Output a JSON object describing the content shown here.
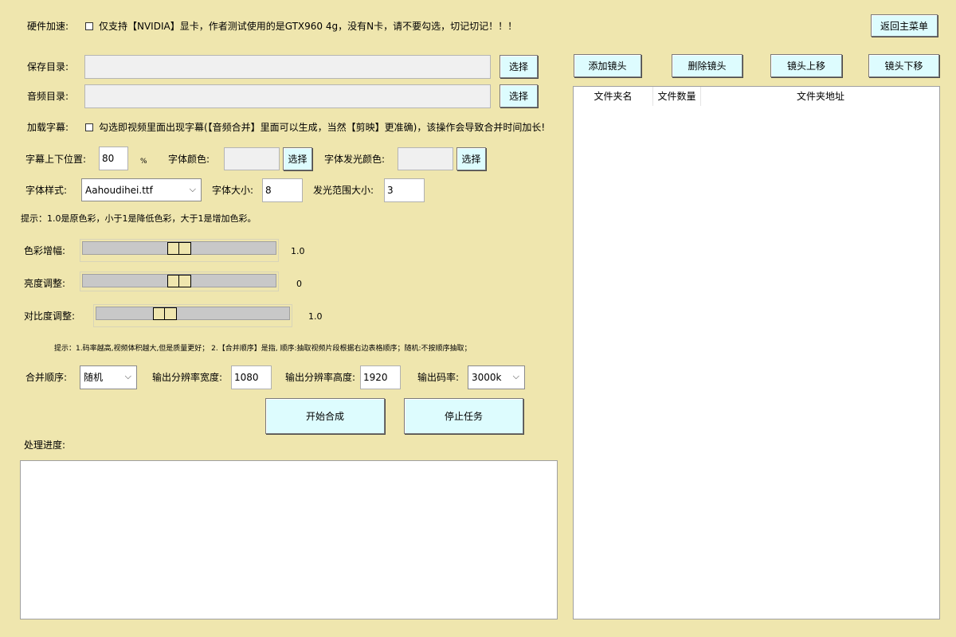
{
  "hardware": {
    "label": "硬件加速:",
    "option_text": "仅支持【NVIDIA】显卡，作者测试使用的是GTX960 4g，没有N卡，请不要勾选，切记切记！！！",
    "checked": false
  },
  "back_button": "返回主菜单",
  "save_dir": {
    "label": "保存目录:",
    "value": "",
    "button": "选择"
  },
  "audio_dir": {
    "label": "音频目录:",
    "value": "",
    "button": "选择"
  },
  "subtitle": {
    "label": "加载字幕:",
    "option_text": "勾选即视频里面出现字幕(【音频合并】里面可以生成，当然【剪映】更准确)，该操作会导致合并时间加长!",
    "checked": false
  },
  "subtitle_position": {
    "label": "字幕上下位置:",
    "value": "80",
    "unit": "%"
  },
  "font_color": {
    "label": "字体颜色:",
    "button": "选择"
  },
  "glow_color": {
    "label": "字体发光颜色:",
    "button": "选择"
  },
  "font_style": {
    "label": "字体样式:",
    "value": "Aahoudihei.ttf"
  },
  "font_size": {
    "label": "字体大小:",
    "value": "8"
  },
  "glow_size": {
    "label": "发光范围大小:",
    "value": "3"
  },
  "hint1": "提示：1.0是原色彩，小于1是降低色彩，大于1是增加色彩。",
  "sliders": [
    {
      "label": "色彩增幅:",
      "value_text": "1.0",
      "level": 0.5
    },
    {
      "label": "亮度调整:",
      "value_text": "0",
      "level": 0.5
    },
    {
      "label": "对比度调整:",
      "value_text": "1.0",
      "level": 0.34
    }
  ],
  "hint2": "提示：1.码率越高,视频体积越大,但是质量更好；  2.【合并顺序】是指,  顺序:抽取视频片段根据右边表格顺序；随机:不按顺序抽取；",
  "merge_order": {
    "label": "合并顺序:",
    "value": "随机"
  },
  "width": {
    "label": "输出分辨率宽度:",
    "value": "1080"
  },
  "height": {
    "label": "输出分辨率高度:",
    "value": "1920"
  },
  "bitrate": {
    "label": "输出码率:",
    "value": "3000k"
  },
  "start_button": "开始合成",
  "stop_button": "停止任务",
  "progress_label": "处理进度:",
  "progress_log": "",
  "toolbar": {
    "add": "添加镜头",
    "delete": "删除镜头",
    "up": "镜头上移",
    "down": "镜头下移"
  },
  "table": {
    "columns": [
      "文件夹名",
      "文件数量",
      "文件夹地址"
    ],
    "rows": []
  }
}
